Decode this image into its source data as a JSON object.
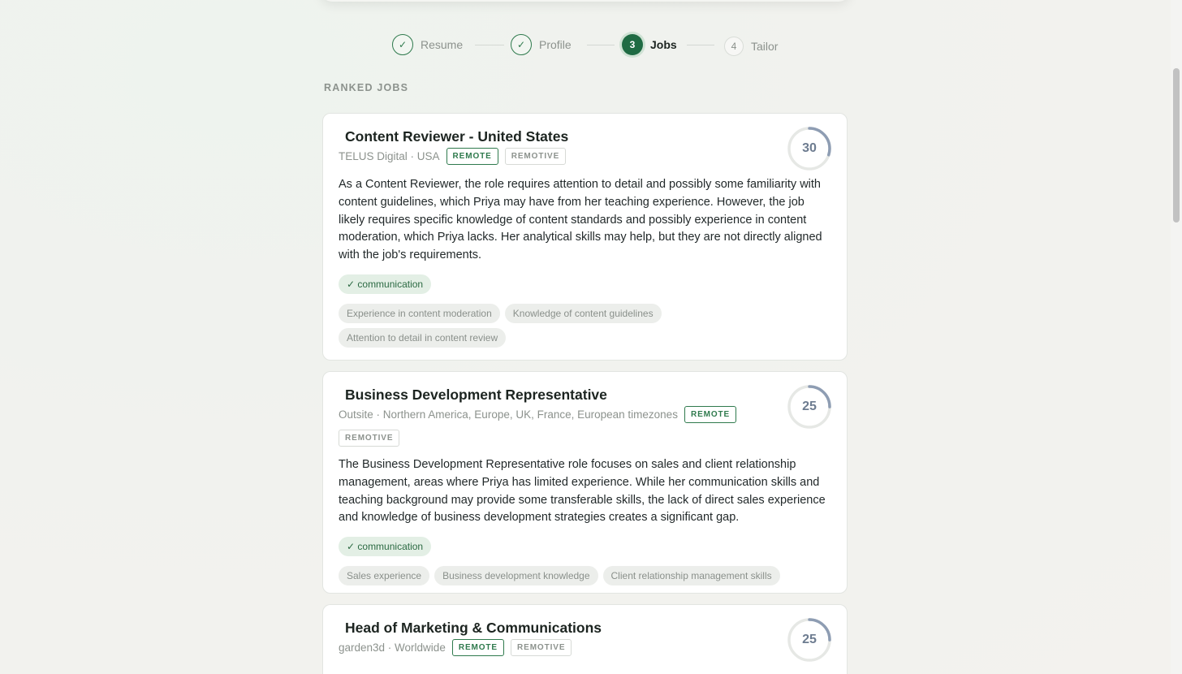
{
  "stepper": [
    {
      "label": "Resume",
      "marker": "✓",
      "state": "done"
    },
    {
      "label": "Profile",
      "marker": "✓",
      "state": "done"
    },
    {
      "label": "Jobs",
      "marker": "3",
      "state": "active"
    },
    {
      "label": "Tailor",
      "marker": "4",
      "state": "todo"
    }
  ],
  "section_label": "RANKED JOBS",
  "jobs": [
    {
      "title": "Content Reviewer - United States",
      "meta": "TELUS Digital · USA",
      "tags": [
        "REMOTE",
        "REMOTIVE"
      ],
      "score": 30,
      "description": "As a Content Reviewer, the role requires attention to detail and possibly some familiarity with content guidelines, which Priya may have from her teaching experience. However, the job likely requires specific knowledge of content standards and possibly experience in content moderation, which Priya lacks. Her analytical skills may help, but they are not directly aligned with the job's requirements.",
      "matches": [
        "✓ communication"
      ],
      "gaps": [
        "Experience in content moderation",
        "Knowledge of content guidelines",
        "Attention to detail in content review"
      ]
    },
    {
      "title": "Business Development Representative",
      "meta": "Outsite · Northern America, Europe, UK, France, European timezones",
      "tags": [
        "REMOTE",
        "REMOTIVE"
      ],
      "score": 25,
      "description": "The Business Development Representative role focuses on sales and client relationship management, areas where Priya has limited experience. While her communication skills and teaching background may provide some transferable skills, the lack of direct sales experience and knowledge of business development strategies creates a significant gap.",
      "matches": [
        "✓ communication"
      ],
      "gaps": [
        "Sales experience",
        "Business development knowledge",
        "Client relationship management skills"
      ]
    },
    {
      "title": "Head of Marketing & Communications",
      "meta": "garden3d · Worldwide",
      "tags": [
        "REMOTE",
        "REMOTIVE"
      ],
      "score": 25
    }
  ],
  "colors": {
    "accent": "#1f6b43",
    "ring": "#8e9db3",
    "ring_track": "#e6e8e5"
  }
}
